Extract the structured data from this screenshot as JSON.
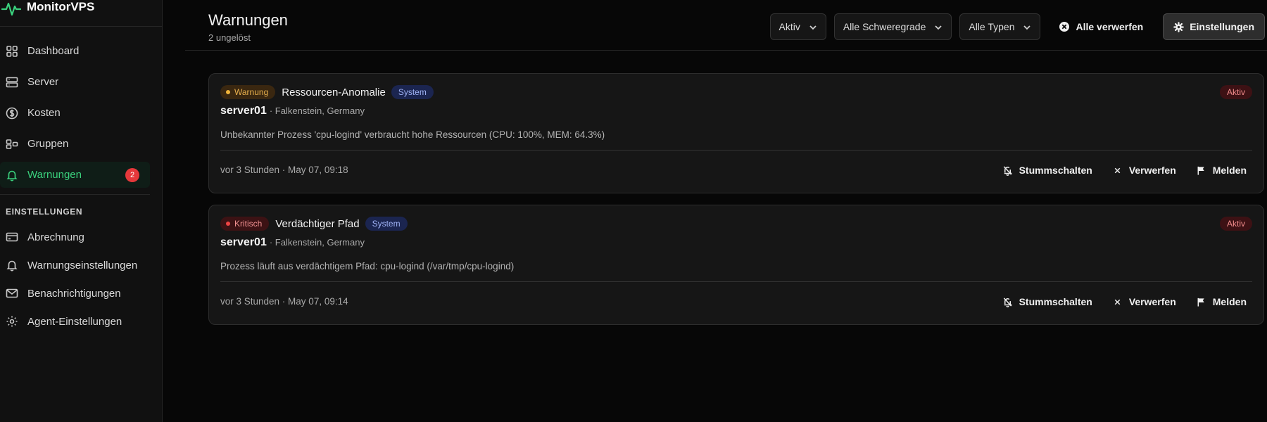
{
  "app": {
    "name": "MonitorVPS",
    "accent": "#3ad17d"
  },
  "sidebar": {
    "items": [
      {
        "label": "Dashboard",
        "icon": "grid-icon"
      },
      {
        "label": "Server",
        "icon": "server-icon"
      },
      {
        "label": "Kosten",
        "icon": "dollar-icon"
      },
      {
        "label": "Gruppen",
        "icon": "groups-icon"
      },
      {
        "label": "Warnungen",
        "icon": "bell-icon",
        "active": true,
        "badge": "2"
      }
    ],
    "section_label": "EINSTELLUNGEN",
    "settings_items": [
      {
        "label": "Abrechnung",
        "icon": "credit-card-icon"
      },
      {
        "label": "Warnungseinstellungen",
        "icon": "bell-icon"
      },
      {
        "label": "Benachrichtigungen",
        "icon": "mail-icon"
      },
      {
        "label": "Agent-Einstellungen",
        "icon": "gear-icon"
      }
    ]
  },
  "header": {
    "title": "Warnungen",
    "subtitle": "2 ungelöst",
    "filters": {
      "status": "Aktiv",
      "severity": "Alle Schweregrade",
      "type": "Alle Typen"
    },
    "dismiss_all_label": "Alle verwerfen",
    "settings_label": "Einstellungen"
  },
  "alerts": [
    {
      "severity": "Warnung",
      "severity_color": "#f0b43a",
      "title": "Ressourcen-Anomalie",
      "type": "System",
      "status": "Aktiv",
      "server": "server01",
      "location": "· Falkenstein, Germany",
      "description": "Unbekannter Prozess 'cpu-logind' verbraucht hohe Ressourcen (CPU: 100%, MEM: 64.3%)",
      "time": "vor 3 Stunden · May 07, 09:18",
      "actions": {
        "mute": "Stummschalten",
        "dismiss": "Verwerfen",
        "report": "Melden"
      }
    },
    {
      "severity": "Kritisch",
      "severity_color": "#ef4444",
      "title": "Verdächtiger Pfad",
      "type": "System",
      "status": "Aktiv",
      "server": "server01",
      "location": "· Falkenstein, Germany",
      "description": "Prozess läuft aus verdächtigem Pfad: cpu-logind (/var/tmp/cpu-logind)",
      "time": "vor 3 Stunden · May 07, 09:14",
      "actions": {
        "mute": "Stummschalten",
        "dismiss": "Verwerfen",
        "report": "Melden"
      }
    }
  ]
}
